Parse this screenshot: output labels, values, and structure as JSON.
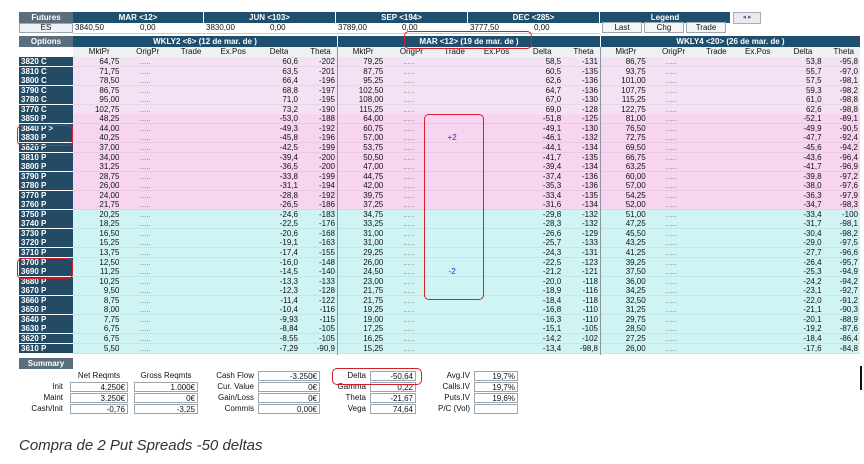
{
  "colors": {
    "header": "#1f4f6e",
    "strike": "#244b66",
    "call_row": "#f4e2f4",
    "put_pink": "#f7d4f0",
    "put_cyan": "#d0f4f4",
    "highlight": "#d4202a",
    "trade_blue": "#1c2ad6"
  },
  "futures": {
    "label": "Futures",
    "symbol": "ES",
    "months": [
      {
        "title": "MAR <12>",
        "last": "3840,50",
        "chg": "0,00"
      },
      {
        "title": "JUN <103>",
        "last": "3830,00",
        "chg": "0,00"
      },
      {
        "title": "SEP <194>",
        "last": "3789,00",
        "chg": "0,00"
      },
      {
        "title": "DEC <285>",
        "last": "3777,50",
        "chg": "0,00"
      }
    ],
    "legend": {
      "title": "Legend",
      "items": [
        "Last",
        "Chg",
        "Trade"
      ]
    }
  },
  "options": {
    "label": "Options",
    "groups": [
      {
        "title": "WKLY2 <6> (12 de mar. de )"
      },
      {
        "title": "MAR <12> (19 de mar. de )"
      },
      {
        "title": "WKLY4 <20> (26 de mar. de )"
      }
    ],
    "columns": [
      "MktPr",
      "OrigPr",
      "Trade",
      "Ex.Pos",
      "Delta",
      "Theta"
    ],
    "rows": [
      {
        "strike": "3820 C",
        "s": "call",
        "v": [
          "64,75",
          ".....",
          "",
          "",
          "60,6",
          "-202",
          "79,25",
          ".....",
          "",
          "",
          "58,5",
          "-131",
          "86,75",
          ".....",
          "",
          "",
          "53,8",
          "-95,8"
        ]
      },
      {
        "strike": "3810 C",
        "s": "call",
        "v": [
          "71,75",
          ".....",
          "",
          "",
          "63,5",
          "-201",
          "87,75",
          ".....",
          "",
          "",
          "60,5",
          "-135",
          "93,75",
          ".....",
          "",
          "",
          "55,7",
          "-97,0"
        ]
      },
      {
        "strike": "3800 C",
        "s": "call",
        "v": [
          "78,50",
          ".....",
          "",
          "",
          "66,4",
          "-196",
          "95,25",
          ".....",
          "",
          "",
          "62,6",
          "-136",
          "101,00",
          ".....",
          "",
          "",
          "57,5",
          "-98,1"
        ]
      },
      {
        "strike": "3790 C",
        "s": "call",
        "v": [
          "86,75",
          ".....",
          "",
          "",
          "68,8",
          "-197",
          "102,50",
          ".....",
          "",
          "",
          "64,7",
          "-136",
          "107,75",
          ".....",
          "",
          "",
          "59,3",
          "-98,2"
        ]
      },
      {
        "strike": "3780 C",
        "s": "call",
        "v": [
          "95,00",
          ".....",
          "",
          "",
          "71,0",
          "-195",
          "108,00",
          ".....",
          "",
          "",
          "67,0",
          "-130",
          "115,25",
          ".....",
          "",
          "",
          "61,0",
          "-98,8"
        ]
      },
      {
        "strike": "3770 C",
        "s": "call",
        "v": [
          "102,75",
          ".....",
          "",
          "",
          "73,2",
          "-190",
          "115,25",
          ".....",
          "",
          "",
          "69,0",
          "-128",
          "122,75",
          ".....",
          "",
          "",
          "62,6",
          "-98,8"
        ]
      },
      {
        "strike": "3850 P",
        "s": "pp",
        "v": [
          "48,25",
          ".....",
          "",
          "",
          "-53,0",
          "-188",
          "64,00",
          ".....",
          "",
          "",
          "-51,8",
          "-125",
          "81,00",
          ".....",
          "",
          "",
          "-52,1",
          "-89,1"
        ]
      },
      {
        "strike": "3840 P >",
        "s": "pp",
        "v": [
          "44,00",
          ".....",
          "",
          "",
          "-49,3",
          "-192",
          "60,75",
          ".....",
          "",
          "",
          "-49,1",
          "-130",
          "76,50",
          ".....",
          "",
          "",
          "-49,9",
          "-90,5"
        ]
      },
      {
        "strike": "3830 P",
        "s": "pp",
        "v": [
          "40,25",
          ".....",
          "",
          "",
          "-45,8",
          "-196",
          "57,00",
          ".....",
          "+2",
          "",
          "-46,1",
          "-132",
          "72,75",
          ".....",
          "",
          "",
          "-47,7",
          "-92,4"
        ]
      },
      {
        "strike": "3820 P",
        "s": "pp",
        "v": [
          "37,00",
          ".....",
          "",
          "",
          "-42,5",
          "-199",
          "53,75",
          ".....",
          "",
          "",
          "-44,1",
          "-134",
          "69,50",
          ".....",
          "",
          "",
          "-45,6",
          "-94,2"
        ]
      },
      {
        "strike": "3810 P",
        "s": "pp",
        "v": [
          "34,00",
          ".....",
          "",
          "",
          "-39,4",
          "-200",
          "50,50",
          ".....",
          "",
          "",
          "-41,7",
          "-135",
          "66,75",
          ".....",
          "",
          "",
          "-43,6",
          "-96,4"
        ]
      },
      {
        "strike": "3800 P",
        "s": "pp",
        "v": [
          "31,25",
          ".....",
          "",
          "",
          "-36,5",
          "-200",
          "47,00",
          ".....",
          "",
          "",
          "-39,4",
          "-134",
          "63,25",
          ".....",
          "",
          "",
          "-41,7",
          "-96,9"
        ]
      },
      {
        "strike": "3790 P",
        "s": "pp",
        "v": [
          "28,75",
          ".....",
          "",
          "",
          "-33,8",
          "-199",
          "44,75",
          ".....",
          "",
          "",
          "-37,4",
          "-136",
          "60,00",
          ".....",
          "",
          "",
          "-39,8",
          "-97,2"
        ]
      },
      {
        "strike": "3780 P",
        "s": "pp",
        "v": [
          "26,00",
          ".....",
          "",
          "",
          "-31,1",
          "-194",
          "42,00",
          ".....",
          "",
          "",
          "-35,3",
          "-136",
          "57,00",
          ".....",
          "",
          "",
          "-38,0",
          "-97,6"
        ]
      },
      {
        "strike": "3770 P",
        "s": "pp",
        "v": [
          "24,00",
          ".....",
          "",
          "",
          "-28,8",
          "-192",
          "39,75",
          ".....",
          "",
          "",
          "-33,4",
          "-135",
          "54,25",
          ".....",
          "",
          "",
          "-36,3",
          "-97,9"
        ]
      },
      {
        "strike": "3760 P",
        "s": "pp",
        "v": [
          "21,75",
          ".....",
          "",
          "",
          "-26,5",
          "-186",
          "37,25",
          ".....",
          "",
          "",
          "-31,6",
          "-134",
          "52,00",
          ".....",
          "",
          "",
          "-34,7",
          "-98,3"
        ]
      },
      {
        "strike": "3750 P",
        "s": "pc",
        "v": [
          "20,25",
          ".....",
          "",
          "",
          "-24,6",
          "-183",
          "34,75",
          ".....",
          "",
          "",
          "-29,8",
          "-132",
          "51,00",
          ".....",
          "",
          "",
          "-33,4",
          "-100"
        ]
      },
      {
        "strike": "3740 P",
        "s": "pc",
        "v": [
          "18,25",
          ".....",
          "",
          "",
          "-22,5",
          "-176",
          "33,25",
          ".....",
          "",
          "",
          "-28,3",
          "-132",
          "47,25",
          ".....",
          "",
          "",
          "-31,7",
          "-98,1"
        ]
      },
      {
        "strike": "3730 P",
        "s": "pc",
        "v": [
          "16,50",
          ".....",
          "",
          "",
          "-20,6",
          "-168",
          "31,00",
          ".....",
          "",
          "",
          "-26,6",
          "-129",
          "45,50",
          ".....",
          "",
          "",
          "-30,4",
          "-98,2"
        ]
      },
      {
        "strike": "3720 P",
        "s": "pc",
        "v": [
          "15,25",
          ".....",
          "",
          "",
          "-19,1",
          "-163",
          "31,00",
          ".....",
          "",
          "",
          "-25,7",
          "-133",
          "43,25",
          ".....",
          "",
          "",
          "-29,0",
          "-97,5"
        ]
      },
      {
        "strike": "3710 P",
        "s": "pc",
        "v": [
          "13,75",
          ".....",
          "",
          "",
          "-17,4",
          "-155",
          "29,25",
          ".....",
          "",
          "",
          "-24,3",
          "-131",
          "41,25",
          ".....",
          "",
          "",
          "-27,7",
          "-96,6"
        ]
      },
      {
        "strike": "3700 P",
        "s": "pc",
        "v": [
          "12,50",
          ".....",
          "",
          "",
          "-16,0",
          "-148",
          "26,00",
          ".....",
          "",
          "",
          "-22,5",
          "-123",
          "39,25",
          ".....",
          "",
          "",
          "-26,4",
          "-95,7"
        ]
      },
      {
        "strike": "3690 P",
        "s": "pc",
        "v": [
          "11,25",
          ".....",
          "",
          "",
          "-14,5",
          "-140",
          "24,50",
          ".....",
          "-2",
          "",
          "-21,2",
          "-121",
          "37,50",
          ".....",
          "",
          "",
          "-25,3",
          "-94,9"
        ]
      },
      {
        "strike": "3680 P",
        "s": "pc",
        "v": [
          "10,25",
          ".....",
          "",
          "",
          "-13,3",
          "-133",
          "23,00",
          ".....",
          "",
          "",
          "-20,0",
          "-118",
          "36,00",
          ".....",
          "",
          "",
          "-24,2",
          "-94,2"
        ]
      },
      {
        "strike": "3670 P",
        "s": "pc",
        "v": [
          "9,50",
          ".....",
          "",
          "",
          "-12,3",
          "-128",
          "21,75",
          ".....",
          "",
          "",
          "-18,9",
          "-116",
          "34,25",
          ".....",
          "",
          "",
          "-23,1",
          "-92,7"
        ]
      },
      {
        "strike": "3660 P",
        "s": "pc",
        "v": [
          "8,75",
          ".....",
          "",
          "",
          "-11,4",
          "-122",
          "21,75",
          ".....",
          "",
          "",
          "-18,4",
          "-118",
          "32,50",
          ".....",
          "",
          "",
          "-22,0",
          "-91,2"
        ]
      },
      {
        "strike": "3650 P",
        "s": "pc",
        "v": [
          "8,00",
          ".....",
          "",
          "",
          "-10,4",
          "-116",
          "19,25",
          ".....",
          "",
          "",
          "-16,8",
          "-110",
          "31,25",
          ".....",
          "",
          "",
          "-21,1",
          "-90,3"
        ]
      },
      {
        "strike": "3640 P",
        "s": "pc",
        "v": [
          "7,75",
          ".....",
          "",
          "",
          "-9,93",
          "-115",
          "19,00",
          ".....",
          "",
          "",
          "-16,3",
          "-110",
          "29,75",
          ".....",
          "",
          "",
          "-20,1",
          "-88,9"
        ]
      },
      {
        "strike": "3630 P",
        "s": "pc",
        "v": [
          "6,75",
          ".....",
          "",
          "",
          "-8,84",
          "-105",
          "17,25",
          ".....",
          "",
          "",
          "-15,1",
          "-105",
          "28,50",
          ".....",
          "",
          "",
          "-19,2",
          "-87,6"
        ]
      },
      {
        "strike": "3620 P",
        "s": "pc",
        "v": [
          "6,75",
          ".....",
          "",
          "",
          "-8,55",
          "-105",
          "16,25",
          ".....",
          "",
          "",
          "-14,2",
          "-102",
          "27,25",
          ".....",
          "",
          "",
          "-18,4",
          "-86,4"
        ]
      },
      {
        "strike": "3610 P",
        "s": "pc",
        "v": [
          "5,50",
          ".....",
          "",
          "",
          "-7,29",
          "-90,9",
          "15,25",
          ".....",
          "",
          "",
          "-13,4",
          "-98,8",
          "26,00",
          ".....",
          "",
          "",
          "-17,6",
          "-84,8"
        ]
      }
    ]
  },
  "summary": {
    "label": "Summary",
    "net_reqmts": "Net Reqmts",
    "gross_reqmts": "Gross Reqmts",
    "init_label": "Init",
    "init_net": "4.250€",
    "init_gross": "1.000€",
    "maint_label": "Maint",
    "maint_net": "3.250€",
    "maint_gross": "0€",
    "cash_label": "Cash/Init",
    "cash_net": "-0,76",
    "cash_gross": "-3,25",
    "cash_flow_label": "Cash Flow",
    "cash_flow": "-3.250€",
    "cur_value_label": "Cur. Value",
    "cur_value": "0€",
    "gain_loss_label": "Gain/Loss",
    "gain_loss": "0€",
    "commis_label": "Commis",
    "commis": "0,00€",
    "delta_label": "Delta",
    "delta": "-50,64",
    "gamma_label": "Gamma",
    "gamma": "0,22",
    "theta_label": "Theta",
    "theta": "-21,67",
    "vega_label": "Vega",
    "vega": "74,64",
    "avgiv_label": "Avg.IV",
    "avgiv": "19,7%",
    "callsiv_label": "Calls.IV",
    "callsiv": "19,7%",
    "putsiv_label": "Puts.IV",
    "putsiv": "19,6%",
    "pc_label": "P/C (Vol)",
    "pc": ""
  },
  "caption": "Compra de 2 Put Spreads  -50 deltas"
}
